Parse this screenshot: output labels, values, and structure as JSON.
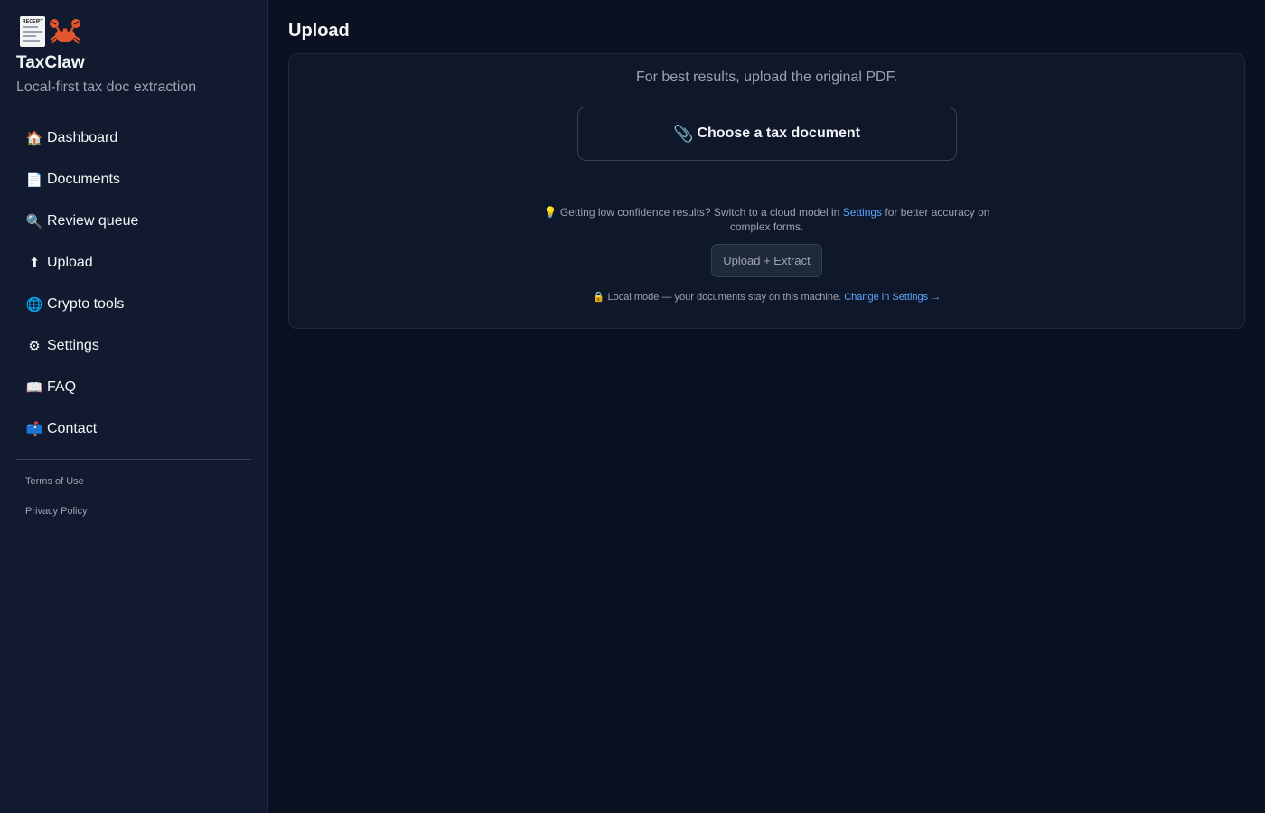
{
  "sidebar": {
    "brand": {
      "receipt_icon_text": "RECEIPT",
      "title": "TaxClaw",
      "subtitle": "Local-first tax doc extraction"
    },
    "items": [
      {
        "label": "Dashboard",
        "icon": "house-icon",
        "glyph": "🏠"
      },
      {
        "label": "Documents",
        "icon": "document-icon",
        "glyph": "📄"
      },
      {
        "label": "Review queue",
        "icon": "magnifier-icon",
        "glyph": "🔍"
      },
      {
        "label": "Upload",
        "icon": "upload-arrow-icon",
        "glyph": "⬆"
      },
      {
        "label": "Crypto tools",
        "icon": "globe-icon",
        "glyph": "🌐"
      },
      {
        "label": "Settings",
        "icon": "gear-icon",
        "glyph": "⚙"
      },
      {
        "label": "FAQ",
        "icon": "book-icon",
        "glyph": "📖"
      },
      {
        "label": "Contact",
        "icon": "mailbox-icon",
        "glyph": "📫"
      }
    ],
    "footer": {
      "terms": "Terms of Use",
      "privacy": "Privacy Policy"
    }
  },
  "main": {
    "title": "Upload",
    "hint": "For best results, upload the original PDF.",
    "choose_label": "Choose a tax document",
    "choose_icon": "paperclip-icon",
    "tip": {
      "icon": "lightbulb-icon",
      "before": "Getting low confidence results? Switch to a cloud model in",
      "link": "Settings",
      "after": "for better accuracy on complex forms."
    },
    "extract_label": "Upload + Extract",
    "local_note": {
      "icon": "lock-icon",
      "text": "Local mode — your documents stay on this machine.",
      "link": "Change in Settings →"
    }
  },
  "colors": {
    "background": "#0b1120",
    "sidebar": "#111a2e",
    "accent_link": "#60a5fa"
  }
}
